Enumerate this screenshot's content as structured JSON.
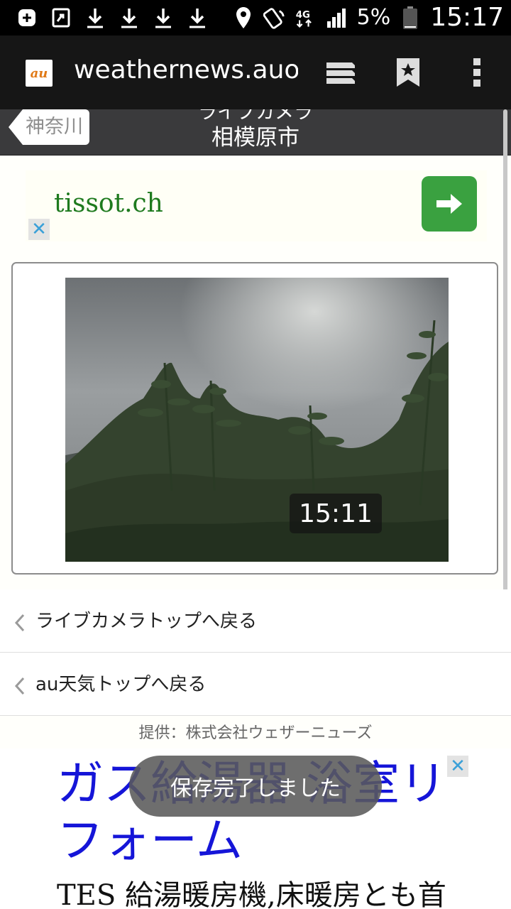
{
  "status_bar": {
    "time": "15:17",
    "battery": "5%",
    "network": "4G",
    "icons": [
      "add-icon",
      "share-icon",
      "download-icon",
      "download-icon",
      "download-icon",
      "download-icon",
      "location-icon",
      "nfc-icon",
      "network-4g-icon",
      "signal-icon",
      "battery-icon"
    ]
  },
  "browser": {
    "url": "weathernews.auone",
    "logo": "au",
    "icons": [
      "tabs-icon",
      "bookmark-icon",
      "menu-icon"
    ]
  },
  "header": {
    "back_label": "神奈川",
    "subtitle": "ライブカメラ",
    "title": "相模原市"
  },
  "ad_top": {
    "text": "tissot.ch",
    "close": "✕",
    "colors": {
      "text": "#1e7a1e",
      "button": "#3aa140"
    }
  },
  "camera": {
    "timestamp": "15:11"
  },
  "links": [
    {
      "label": "ライブカメラトップへ戻る"
    },
    {
      "label": "au天気トップへ戻る"
    }
  ],
  "credit": "提供：株式会社ウェザーニューズ",
  "ad_bottom": {
    "title": "ガス給湯器 浴室リフォーム",
    "body": "TES 給湯暖房機,床暖房とも首",
    "close": "✕",
    "colors": {
      "title": "#1515d8"
    }
  },
  "toast": "保存完了しました"
}
